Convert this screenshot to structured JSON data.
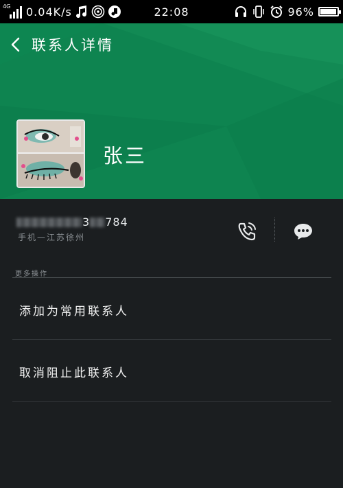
{
  "status_bar": {
    "network_type": "4G",
    "speed": "0.04K/s",
    "time": "22:08",
    "battery": "96%",
    "battery_level": 0.96
  },
  "header": {
    "back_icon": "chevron-left-icon",
    "title": "联系人详情",
    "contact_name": "张三",
    "background_color": "#0e8450"
  },
  "phone": {
    "number_visible_suffix": "3",
    "number_visible_end": "784",
    "location": "手机—江苏徐州",
    "call_icon": "phone-call-icon",
    "message_icon": "chat-bubble-icon"
  },
  "more_actions": {
    "section_title": "更多操作",
    "items": [
      {
        "label": "添加为常用联系人"
      },
      {
        "label": "取消阻止此联系人"
      }
    ]
  }
}
